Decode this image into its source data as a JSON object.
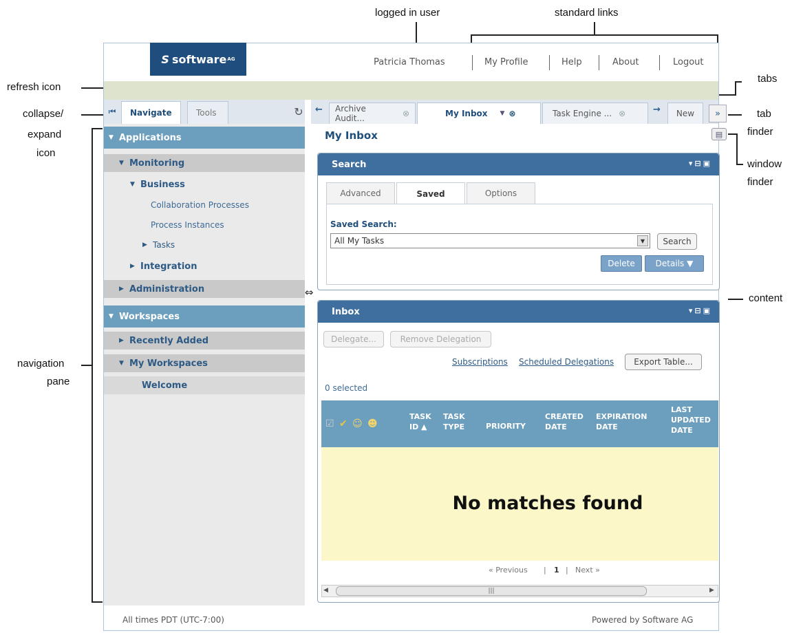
{
  "callouts": {
    "logged_in_user": "logged in user",
    "standard_links": "standard links",
    "refresh_icon": "refresh icon",
    "tabs": "tabs",
    "collapse_expand_1": "collapse/",
    "collapse_expand_2": "expand",
    "collapse_expand_3": "icon",
    "tab_finder_1": "tab",
    "tab_finder_2": "finder",
    "window_finder_1": "window",
    "window_finder_2": "finder",
    "resize_icon": "resize icon",
    "content": "content",
    "navigation_pane_1": "navigation",
    "navigation_pane_2": "pane"
  },
  "header": {
    "logo_text": "software",
    "logo_mark": "S",
    "logo_tm": "AG",
    "user": "Patricia Thomas",
    "links": [
      "My Profile",
      "Help",
      "About",
      "Logout"
    ]
  },
  "nav": {
    "tabs": [
      "Navigate",
      "Tools"
    ],
    "items": {
      "applications": "Applications",
      "monitoring": "Monitoring",
      "business": "Business",
      "collab": "Collaboration Processes",
      "process_instances": "Process Instances",
      "tasks": "Tasks",
      "integration": "Integration",
      "administration": "Administration",
      "workspaces": "Workspaces",
      "recently_added": "Recently Added",
      "my_workspaces": "My Workspaces",
      "welcome": "Welcome"
    }
  },
  "content_tabs": [
    "Archive Audit...",
    "My Inbox",
    "Task Engine ...",
    "New"
  ],
  "page_title": "My Inbox",
  "search_panel": {
    "title": "Search",
    "tabs": [
      "Advanced",
      "Saved",
      "Options"
    ],
    "saved_search_label": "Saved Search:",
    "saved_search_value": "All My Tasks",
    "search_button": "Search",
    "delete_button": "Delete",
    "details_button": "Details ▼"
  },
  "inbox_panel": {
    "title": "Inbox",
    "delegate_button": "Delegate...",
    "remove_delegation_button": "Remove Delegation",
    "subscriptions_link": "Subscriptions",
    "scheduled_delegations_link": "Scheduled Delegations",
    "export_button": "Export Table...",
    "selected_count": "0 selected",
    "columns": {
      "task_id_1": "TASK",
      "task_id_2": "ID ▲",
      "task_type_1": "TASK",
      "task_type_2": "TYPE",
      "priority": "PRIORITY",
      "created_1": "CREATED",
      "created_2": "DATE",
      "expiration_1": "EXPIRATION",
      "expiration_2": "DATE",
      "last_1": "LAST",
      "last_2": "UPDATED",
      "last_3": "DATE"
    },
    "empty_message": "No matches found",
    "pager_prev": "« Previous",
    "pager_page": "1",
    "pager_next": "Next »"
  },
  "footer": {
    "timezone": "All times PDT (UTC-7:00)",
    "powered_by": "Powered by Software AG"
  },
  "colors": {
    "accent_blue": "#3f6f9f",
    "nav_blue": "#6c9ebd",
    "empty_bg": "#fbf7c9"
  }
}
